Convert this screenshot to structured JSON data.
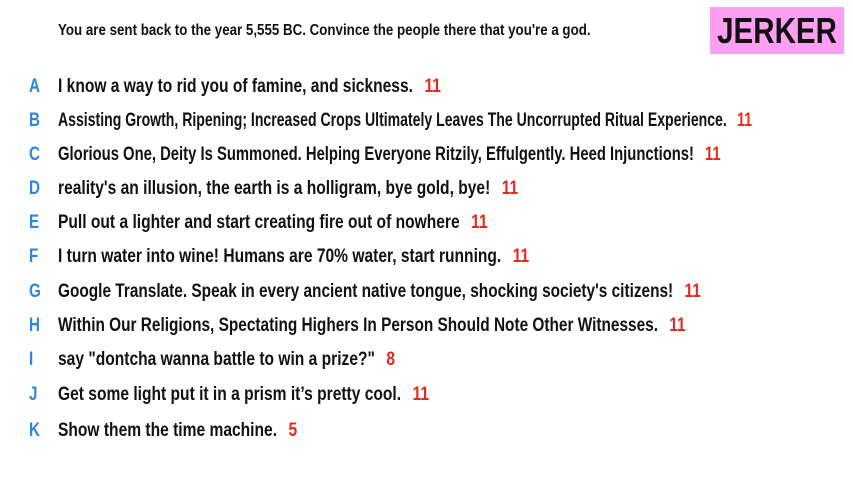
{
  "prompt": "You are sent back to the year 5,555 BC. Convince the people there that you're a god.",
  "badge": "JERKER",
  "colors": {
    "letter": "#2e86de",
    "score": "#e8281e",
    "badge_bg": "#ff9ff3",
    "text": "#111111"
  },
  "answers": [
    {
      "letter": "A",
      "text": "I know a way to rid you of famine, and sickness.",
      "score": "11"
    },
    {
      "letter": "B",
      "text": "Assisting Growth, Ripening; Increased Crops Ultimately Leaves The Uncorrupted Ritual Experience.",
      "score": "11"
    },
    {
      "letter": "C",
      "text": "Glorious One, Deity Is Summoned. Helping Everyone Ritzily, Effulgently. Heed Injunctions!",
      "score": "11"
    },
    {
      "letter": "D",
      "text": "reality's an illusion, the earth is a holligram, bye gold, bye!",
      "score": "11"
    },
    {
      "letter": "E",
      "text": "Pull out a lighter and start creating fire out of nowhere",
      "score": "11"
    },
    {
      "letter": "F",
      "text": "I turn water into wine! Humans are 70% water, start running.",
      "score": "11"
    },
    {
      "letter": "G",
      "text": "Google Translate. Speak in every ancient native tongue, shocking society's citizens!",
      "score": "11"
    },
    {
      "letter": "H",
      "text": "Within Our Religions, Spectating Highers In Person Should Note Other Witnesses.",
      "score": "11"
    },
    {
      "letter": "I",
      "text": "say \"dontcha wanna battle to win a prize?\"",
      "score": "8"
    },
    {
      "letter": "J",
      "text": "Get some light put it in a prism it’s pretty cool.",
      "score": "11"
    },
    {
      "letter": "K",
      "text": "Show them the time machine.",
      "score": "5"
    }
  ]
}
